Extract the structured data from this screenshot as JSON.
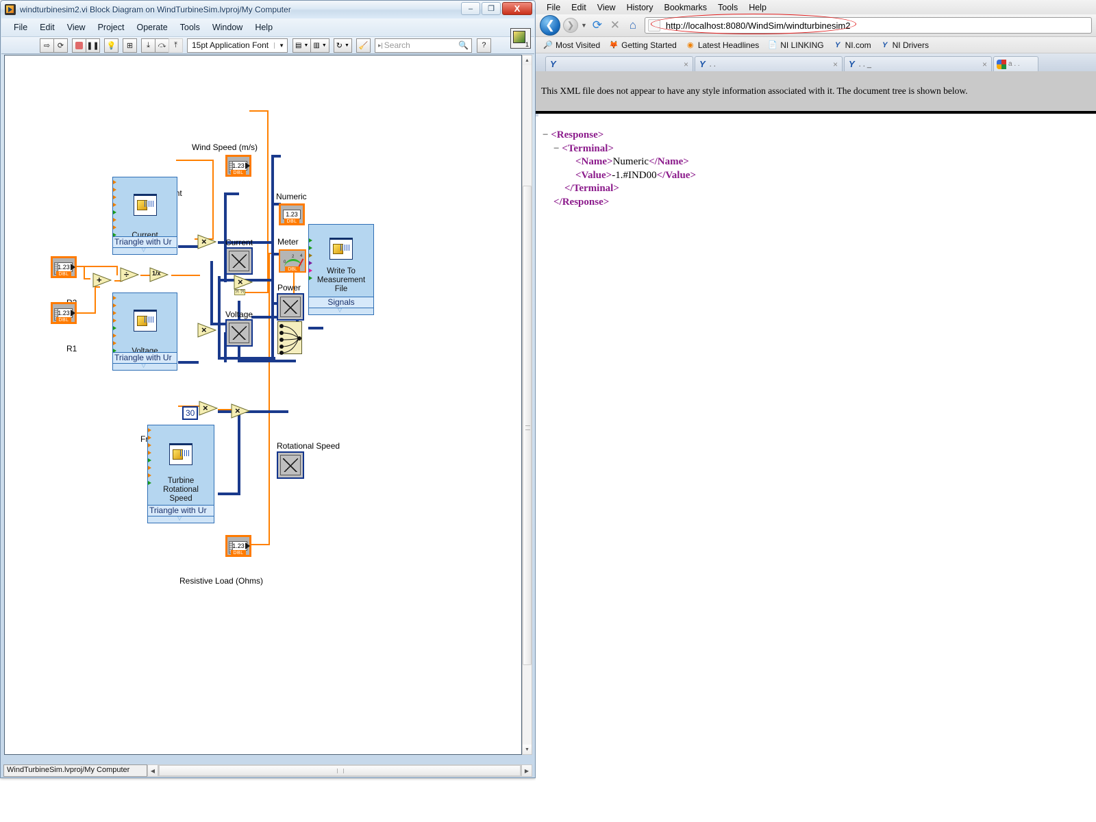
{
  "labview": {
    "window_title": "windturbinesim2.vi Block Diagram on WindTurbineSim.lvproj/My Computer",
    "window_buttons": {
      "minimize": "–",
      "maximize": "❐",
      "close": "X"
    },
    "menu": [
      "File",
      "Edit",
      "View",
      "Project",
      "Operate",
      "Tools",
      "Window",
      "Help"
    ],
    "toolbar": {
      "run": "run-arrow",
      "run_continuously": "run-continuous",
      "abort": "abort-stop",
      "pause": "pause",
      "highlight_execution": "lightbulb",
      "retain_wire_values": "retain-values",
      "step_into": "step-into",
      "step_over": "step-over",
      "step_out": "step-out",
      "font_selector": "15pt Application Font",
      "align_objects": "align-objects",
      "distribute_objects": "distribute-objects",
      "reorder": "reorder",
      "clean_up_diagram": "clean-up-diagram",
      "search_placeholder": "Search",
      "search_value": "",
      "help_label": "?",
      "vi_icon_badge": "1"
    },
    "status_bar": "WindTurbineSim.lvproj/My Computer",
    "diagram": {
      "labels": {
        "wind_speed": "Wind Speed (m/s)",
        "current_shunt": "Current Shunt",
        "numeric": "Numeric",
        "meter": "Meter",
        "power": "Power",
        "current_graph": "Current",
        "voltage_graph": "Voltage",
        "r2": "R2",
        "r1": "R1",
        "freq_to_vol": "Freq to Vol",
        "rotational_speed": "Rotational Speed",
        "resistive_load": "Resistive Load (Ohms)"
      },
      "subvis": [
        {
          "name": "current-simulate-signal",
          "caption": "Current",
          "config": "Triangle with Ur"
        },
        {
          "name": "voltage-simulate-signal",
          "caption": "Voltage",
          "config": "Triangle with Ur"
        },
        {
          "name": "turbine-rotational-speed-simulate-signal",
          "caption": "Turbine\nRotational\nSpeed",
          "config": "Triangle with Ur"
        },
        {
          "name": "write-to-measurement-file",
          "caption": "Write To\nMeasurement\nFile",
          "config": "Signals"
        }
      ],
      "controls": [
        {
          "name": "wind-speed-control",
          "value": "1.23",
          "type": "DBL"
        },
        {
          "name": "current-shunt-control",
          "value": "1.23",
          "type": "DBL"
        },
        {
          "name": "r2-control",
          "value": "1.23",
          "type": "DBL"
        },
        {
          "name": "r1-control",
          "value": "1.23",
          "type": "DBL"
        },
        {
          "name": "freq-to-vol-control",
          "value": "1.23",
          "type": "DBL"
        },
        {
          "name": "resistive-load-control",
          "value": "1.23",
          "type": "DBL"
        },
        {
          "name": "numeric-indicator",
          "value": "1.23",
          "type": "DBL"
        }
      ],
      "constants": [
        {
          "name": "gear-ratio-constant",
          "value": "30"
        }
      ],
      "functions": [
        "multiply",
        "multiply",
        "multiply",
        "multiply",
        "multiply",
        "add",
        "divide",
        "reciprocal"
      ],
      "colors": {
        "control_border": "#ff7b00",
        "indicator_border": "#11348c",
        "wire_numeric": "#ff8000",
        "wire_dynamic": "#1a3a8c",
        "subvi_fill": "#b5d6f0"
      }
    }
  },
  "browser": {
    "menu": [
      "File",
      "Edit",
      "View",
      "History",
      "Bookmarks",
      "Tools",
      "Help"
    ],
    "nav": {
      "back": "back-arrow",
      "forward": "forward-arrow",
      "reload": "reload-icon",
      "stop": "stop-icon",
      "home": "home-icon"
    },
    "url": "http://localhost:8080/WindSim/windturbinesim2",
    "url_highlight_color": "#e01b1b",
    "bookmarks": [
      {
        "label": "Most Visited",
        "icon": "most-visited-icon"
      },
      {
        "label": "Getting Started",
        "icon": "firefox-icon"
      },
      {
        "label": "Latest Headlines",
        "icon": "rss-icon"
      },
      {
        "label": "NI LINKING",
        "icon": "page-icon"
      },
      {
        "label": "NI.com",
        "icon": "ni-icon"
      },
      {
        "label": "NI Drivers",
        "icon": "ni-icon"
      }
    ],
    "tabs": [
      {
        "title": "",
        "icon": "ni-icon",
        "close": "×"
      },
      {
        "title": ".    .",
        "icon": "ni-icon",
        "close": "×"
      },
      {
        "title": ". .          _",
        "icon": "ni-icon",
        "close": "×"
      }
    ],
    "search_box": {
      "icon": "google-icon",
      "placeholder": "a . ."
    },
    "notice": "This XML file does not appear to have any style information associated with it. The document tree is shown below.",
    "xml": [
      {
        "indent": 0,
        "marker": "−",
        "parts": [
          {
            "t": "<Response>",
            "k": "tag"
          }
        ]
      },
      {
        "indent": 1,
        "marker": "−",
        "parts": [
          {
            "t": "<Terminal>",
            "k": "tag"
          }
        ]
      },
      {
        "indent": 3,
        "marker": "",
        "parts": [
          {
            "t": "<Name>",
            "k": "tag"
          },
          {
            "t": "Numeric",
            "k": "txt"
          },
          {
            "t": "</Name>",
            "k": "tag"
          }
        ]
      },
      {
        "indent": 3,
        "marker": "",
        "parts": [
          {
            "t": "<Value>",
            "k": "tag"
          },
          {
            "t": "-1.#IND00",
            "k": "txt"
          },
          {
            "t": "</Value>",
            "k": "tag"
          }
        ]
      },
      {
        "indent": 2,
        "marker": "",
        "parts": [
          {
            "t": "</Terminal>",
            "k": "tag"
          }
        ]
      },
      {
        "indent": 1,
        "marker": "",
        "parts": [
          {
            "t": "</Response>",
            "k": "tag"
          }
        ]
      }
    ]
  }
}
